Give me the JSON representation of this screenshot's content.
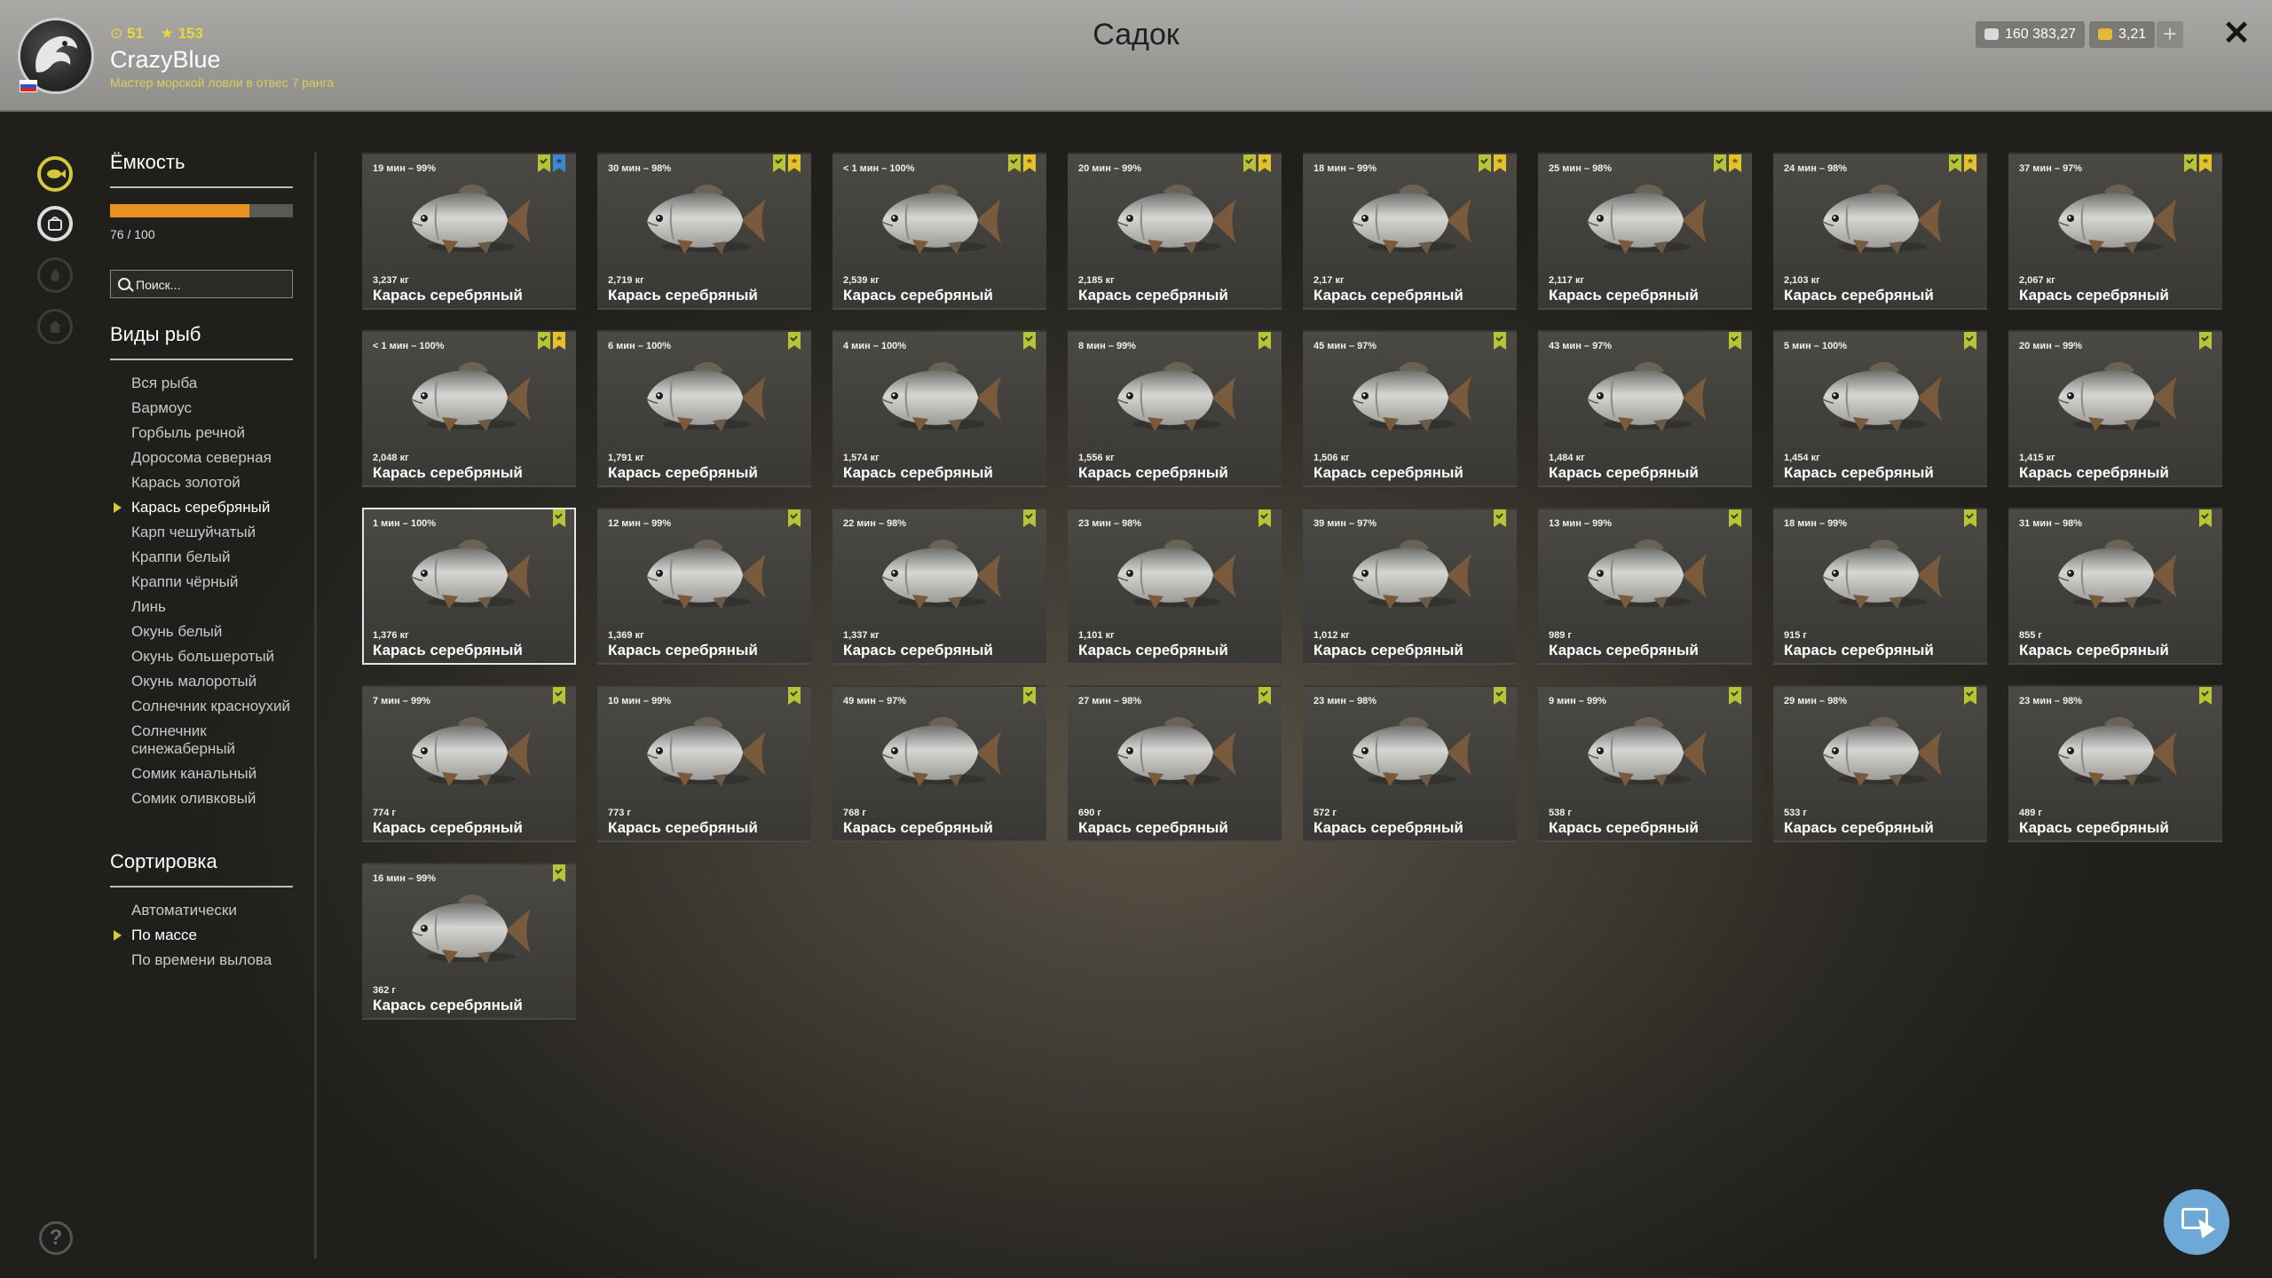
{
  "header": {
    "title": "Садок",
    "player": {
      "level": "51",
      "stars": "153",
      "name": "CrazyBlue",
      "rank": "Мастер морской ловли в отвес 7 ранга"
    },
    "silver": "160 383,27",
    "gold": "3,21",
    "plus_label": "+",
    "close_label": "✕"
  },
  "capacity": {
    "title": "Ёмкость",
    "text": "76 / 100",
    "fill_fraction": 0.76
  },
  "search": {
    "placeholder": "Поиск..."
  },
  "species": {
    "title": "Виды рыб",
    "items": [
      "Вся рыба",
      "Вармоус",
      "Горбыль речной",
      "Доросома северная",
      "Карась золотой",
      "Карась серебряный",
      "Карп чешуйчатый",
      "Краппи белый",
      "Краппи чёрный",
      "Линь",
      "Окунь белый",
      "Окунь большеротый",
      "Окунь малоротый",
      "Солнечник красноухий",
      "Солнечник синежаберный",
      "Сомик канальный",
      "Сомик оливковый"
    ],
    "selected": 5
  },
  "sort": {
    "title": "Сортировка",
    "items": [
      "Автоматически",
      "По массе",
      "По времени вылова"
    ],
    "selected": 1
  },
  "colors": {
    "accent": "#d4c93a",
    "capacity_fill": "#e89320",
    "trophy_badge": "#b6c537",
    "star_badge": "#e4c22e",
    "blue_badge": "#3f86d0"
  },
  "fish": [
    {
      "time": "19 мин – 99%",
      "weight": "3,237 кг",
      "name": "Карась серебряный",
      "badges": [
        "trophy",
        "blue"
      ]
    },
    {
      "time": "30 мин – 98%",
      "weight": "2,719 кг",
      "name": "Карась серебряный",
      "badges": [
        "trophy",
        "star"
      ]
    },
    {
      "time": "< 1 мин – 100%",
      "weight": "2,539 кг",
      "name": "Карась серебряный",
      "badges": [
        "trophy",
        "star"
      ]
    },
    {
      "time": "20 мин – 99%",
      "weight": "2,185 кг",
      "name": "Карась серебряный",
      "badges": [
        "trophy",
        "star"
      ]
    },
    {
      "time": "18 мин – 99%",
      "weight": "2,17 кг",
      "name": "Карась серебряный",
      "badges": [
        "trophy",
        "star"
      ]
    },
    {
      "time": "25 мин – 98%",
      "weight": "2,117 кг",
      "name": "Карась серебряный",
      "badges": [
        "trophy",
        "star"
      ]
    },
    {
      "time": "24 мин – 98%",
      "weight": "2,103 кг",
      "name": "Карась серебряный",
      "badges": [
        "trophy",
        "star"
      ]
    },
    {
      "time": "37 мин – 97%",
      "weight": "2,067 кг",
      "name": "Карась серебряный",
      "badges": [
        "trophy",
        "star"
      ]
    },
    {
      "time": "< 1 мин – 100%",
      "weight": "2,048 кг",
      "name": "Карась серебряный",
      "badges": [
        "trophy",
        "star"
      ]
    },
    {
      "time": "6 мин – 100%",
      "weight": "1,791 кг",
      "name": "Карась серебряный",
      "badges": [
        "trophy"
      ]
    },
    {
      "time": "4 мин – 100%",
      "weight": "1,574 кг",
      "name": "Карась серебряный",
      "badges": [
        "trophy"
      ]
    },
    {
      "time": "8 мин – 99%",
      "weight": "1,556 кг",
      "name": "Карась серебряный",
      "badges": [
        "trophy"
      ]
    },
    {
      "time": "45 мин – 97%",
      "weight": "1,506 кг",
      "name": "Карась серебряный",
      "badges": [
        "trophy"
      ]
    },
    {
      "time": "43 мин – 97%",
      "weight": "1,484 кг",
      "name": "Карась серебряный",
      "badges": [
        "trophy"
      ]
    },
    {
      "time": "5 мин – 100%",
      "weight": "1,454 кг",
      "name": "Карась серебряный",
      "badges": [
        "trophy"
      ]
    },
    {
      "time": "20 мин – 99%",
      "weight": "1,415 кг",
      "name": "Карась серебряный",
      "badges": [
        "trophy"
      ]
    },
    {
      "time": "1 мин – 100%",
      "weight": "1,376 кг",
      "name": "Карась серебряный",
      "badges": [
        "trophy"
      ],
      "selected": true
    },
    {
      "time": "12 мин – 99%",
      "weight": "1,369 кг",
      "name": "Карась серебряный",
      "badges": [
        "trophy"
      ]
    },
    {
      "time": "22 мин – 98%",
      "weight": "1,337 кг",
      "name": "Карась серебряный",
      "badges": [
        "trophy"
      ]
    },
    {
      "time": "23 мин – 98%",
      "weight": "1,101 кг",
      "name": "Карась серебряный",
      "badges": [
        "trophy"
      ]
    },
    {
      "time": "39 мин – 97%",
      "weight": "1,012 кг",
      "name": "Карась серебряный",
      "badges": [
        "trophy"
      ]
    },
    {
      "time": "13 мин – 99%",
      "weight": "989 г",
      "name": "Карась серебряный",
      "badges": [
        "trophy"
      ]
    },
    {
      "time": "18 мин – 99%",
      "weight": "915 г",
      "name": "Карась серебряный",
      "badges": [
        "trophy"
      ]
    },
    {
      "time": "31 мин – 98%",
      "weight": "855 г",
      "name": "Карась серебряный",
      "badges": [
        "trophy"
      ]
    },
    {
      "time": "7 мин – 99%",
      "weight": "774 г",
      "name": "Карась серебряный",
      "badges": [
        "trophy"
      ]
    },
    {
      "time": "10 мин – 99%",
      "weight": "773 г",
      "name": "Карась серебряный",
      "badges": [
        "trophy"
      ]
    },
    {
      "time": "49 мин – 97%",
      "weight": "768 г",
      "name": "Карась серебряный",
      "badges": [
        "trophy"
      ]
    },
    {
      "time": "27 мин – 98%",
      "weight": "690 г",
      "name": "Карась серебряный",
      "badges": [
        "trophy"
      ]
    },
    {
      "time": "23 мин – 98%",
      "weight": "572 г",
      "name": "Карась серебряный",
      "badges": [
        "trophy"
      ]
    },
    {
      "time": "9 мин – 99%",
      "weight": "538 г",
      "name": "Карась серебряный",
      "badges": [
        "trophy"
      ]
    },
    {
      "time": "29 мин – 98%",
      "weight": "533 г",
      "name": "Карась серебряный",
      "badges": [
        "trophy"
      ]
    },
    {
      "time": "23 мин – 98%",
      "weight": "489 г",
      "name": "Карась серебряный",
      "badges": [
        "trophy"
      ]
    },
    {
      "time": "16 мин – 99%",
      "weight": "362 г",
      "name": "Карась серебряный",
      "badges": [
        "trophy"
      ]
    }
  ]
}
